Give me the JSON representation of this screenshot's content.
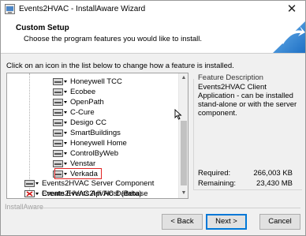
{
  "window": {
    "title": "Events2HVAC - InstallAware Wizard"
  },
  "header": {
    "title": "Custom Setup",
    "subtitle": "Choose the program features you would like to install."
  },
  "instructions": "Click on an icon in the list below to change how a feature is installed.",
  "tree": {
    "children": [
      {
        "label": "Honeywell TCC"
      },
      {
        "label": "Ecobee"
      },
      {
        "label": "OpenPath"
      },
      {
        "label": "C-Cure"
      },
      {
        "label": "Desigo CC"
      },
      {
        "label": "SmartBuildings"
      },
      {
        "label": "Honeywell Home"
      },
      {
        "label": "ControlByWeb"
      },
      {
        "label": "Venstar"
      },
      {
        "label": "Verkada"
      }
    ],
    "top_level": [
      {
        "label": "Events2HVAC Server Component"
      },
      {
        "label": "Events2HVAC Api Host (Beta)"
      },
      {
        "label": "Create Events2HVAC Database"
      }
    ]
  },
  "description": {
    "title": "Feature Description",
    "text": "Events2HVAC Client Application - can be installed stand-alone or with the server component.",
    "required_label": "Required:",
    "required_value": "266,003 KB",
    "remaining_label": "Remaining:",
    "remaining_value": "23,430 MB"
  },
  "footer": {
    "brand": "InstallAware",
    "back": "< Back",
    "next": "Next >",
    "cancel": "Cancel"
  },
  "colors": {
    "highlight": "#e02424",
    "accent": "#0078d7"
  }
}
